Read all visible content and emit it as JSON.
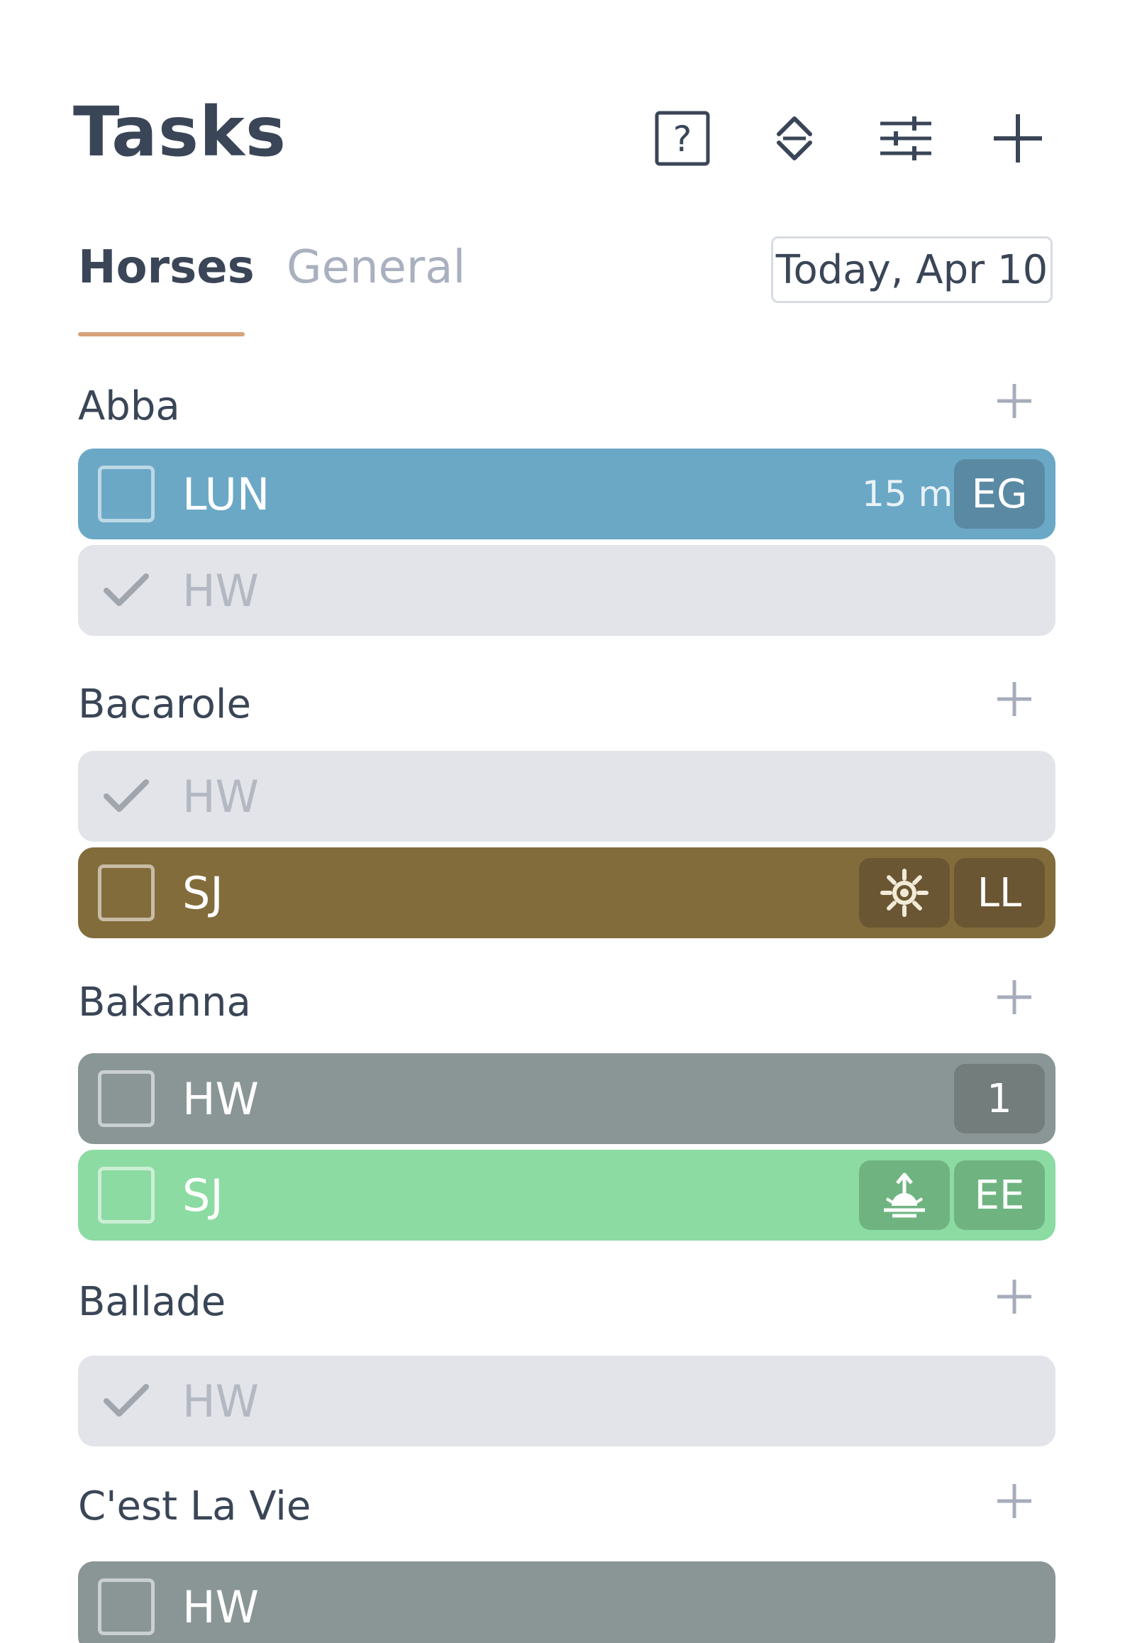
{
  "header": {
    "title": "Tasks",
    "icons": [
      "help-icon",
      "sort-icon",
      "filter-icon",
      "add-icon"
    ]
  },
  "tabs": [
    {
      "label": "Horses",
      "active": true
    },
    {
      "label": "General",
      "active": false
    }
  ],
  "date_label": "Today, Apr 10",
  "colors": {
    "blue": "#6ba8c6",
    "brown": "#836c3b",
    "grey": "#899695",
    "green": "#8cdba2",
    "done": "#e2e4e9",
    "accent": "#d9a27a"
  },
  "groups": [
    {
      "name": "Abba",
      "tasks": [
        {
          "label": "LUN",
          "done": false,
          "color": "blue",
          "duration": "15 m",
          "badge": "EG"
        },
        {
          "label": "HW",
          "done": true
        }
      ]
    },
    {
      "name": "Bacarole",
      "tasks": [
        {
          "label": "HW",
          "done": true
        },
        {
          "label": "SJ",
          "done": false,
          "color": "brown",
          "icon": "sun-icon",
          "badge": "LL"
        }
      ]
    },
    {
      "name": "Bakanna",
      "tasks": [
        {
          "label": "HW",
          "done": false,
          "color": "grey",
          "badge": "1"
        },
        {
          "label": "SJ",
          "done": false,
          "color": "green",
          "icon": "sunrise-icon",
          "badge": "EE"
        }
      ]
    },
    {
      "name": "Ballade",
      "tasks": [
        {
          "label": "HW",
          "done": true
        }
      ]
    },
    {
      "name": "C'est La Vie",
      "tasks": [
        {
          "label": "HW",
          "done": false,
          "color": "grey"
        }
      ]
    }
  ]
}
